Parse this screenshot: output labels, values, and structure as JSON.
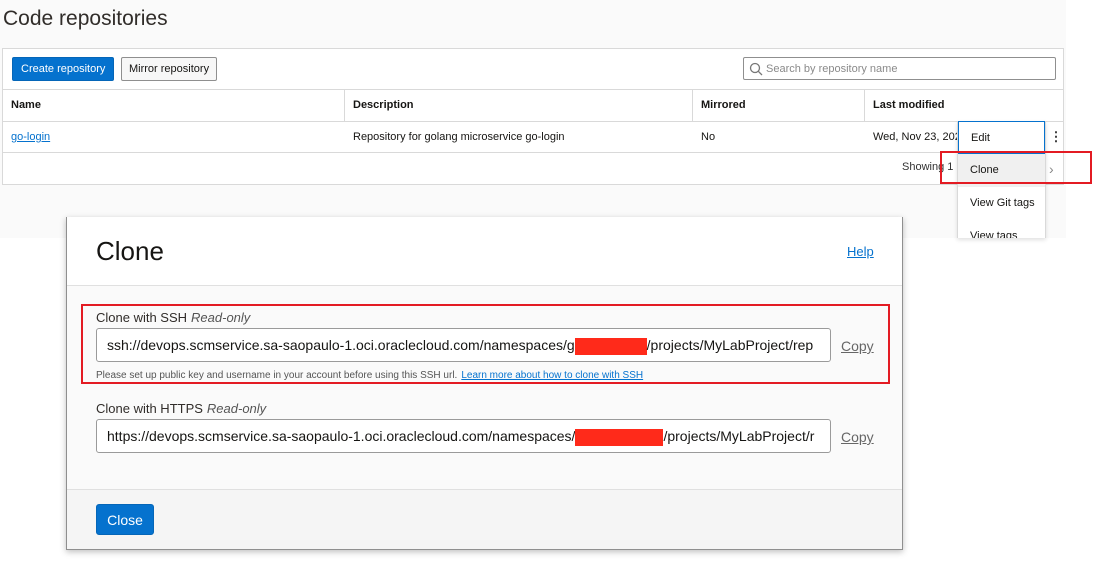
{
  "page": {
    "title": "Code repositories"
  },
  "toolbar": {
    "create_label": "Create repository",
    "mirror_label": "Mirror repository",
    "search_placeholder": "Search by repository name"
  },
  "table": {
    "columns": [
      "Name",
      "Description",
      "Mirrored",
      "Last modified"
    ],
    "rows": [
      {
        "name": "go-login",
        "description": "Repository for golang microservice go-login",
        "mirrored": "No",
        "last_modified": "Wed, Nov 23, 202"
      }
    ],
    "showing_text": "Showing 1 it"
  },
  "row_menu": {
    "kebab": "⋮",
    "items": [
      "Edit",
      "Clone",
      "View Git tags",
      "View tags"
    ]
  },
  "dialog": {
    "title": "Clone",
    "help_label": "Help",
    "ssh": {
      "label": "Clone with SSH",
      "mode": "Read-only",
      "url_prefix": "ssh://devops.scmservice.sa-saopaulo-1.oci.oraclecloud.com/namespaces/g",
      "url_suffix": "/projects/MyLabProject/rep",
      "copy_label": "Copy",
      "hint": "Please set up public key and username in your account before using this SSH url.",
      "hint_link": "Learn more about how to clone with SSH"
    },
    "https": {
      "label": "Clone with HTTPS",
      "mode": "Read-only",
      "url_prefix": "https://devops.scmservice.sa-saopaulo-1.oci.oraclecloud.com/namespaces/",
      "url_suffix": "/projects/MyLabProject/r",
      "copy_label": "Copy"
    },
    "close_label": "Close"
  },
  "colors": {
    "accent": "#0572ce",
    "highlight": "#e31b23",
    "redaction": "#ff2a1a"
  }
}
